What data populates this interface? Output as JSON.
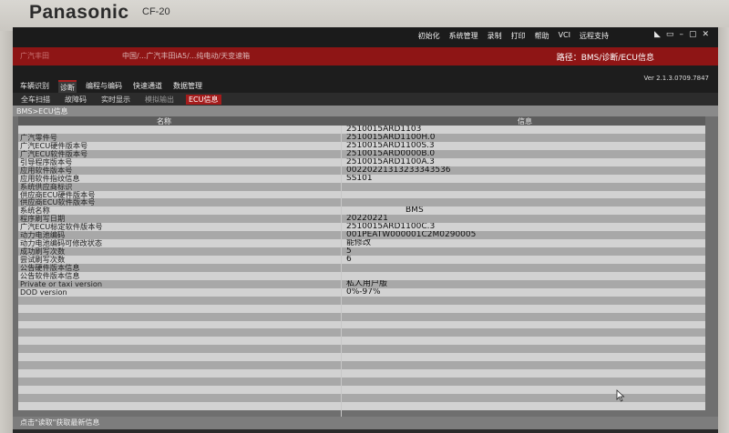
{
  "device": {
    "brand": "Panasonic",
    "model": "CF-20"
  },
  "topmenu": [
    "初始化",
    "系统管理",
    "录制",
    "打印",
    "帮助",
    "VCI",
    "远程支持"
  ],
  "header": {
    "logo_text": "广汽丰田",
    "crumb_path": "中国/...广汽丰田iA5/...纯电动/天变速箱",
    "path_label": "路径：BMS/诊断/ECU信息",
    "version": "Ver 2.1.3.0709.7847"
  },
  "nav": {
    "tabs": [
      "车辆识别",
      "诊断",
      "编程与编码",
      "快速通道",
      "数据管理"
    ],
    "active_tab": "诊断",
    "subtabs": [
      "全车扫描",
      "故障码",
      "实时显示",
      "模拟输出",
      "ECU信息"
    ],
    "active_subtab": "ECU信息"
  },
  "breadcrumb": "BMS>ECU信息",
  "table": {
    "col_name": "名称",
    "col_info": "信息",
    "rows": [
      {
        "name": "",
        "value": "2510015ARD1103"
      },
      {
        "name": "广汽零件号",
        "value": "2510015ARD1100H.0"
      },
      {
        "name": "广汽ECU硬件版本号",
        "value": "2510015ARD1100S.3"
      },
      {
        "name": "广汽ECU软件版本号",
        "value": "2510015ARD0000B.0"
      },
      {
        "name": "引导程序版本号",
        "value": "2510015ARD1100A.3"
      },
      {
        "name": "应用软件版本号",
        "value": "00220221313233343536"
      },
      {
        "name": "应用软件指纹信息",
        "value": "SS101"
      },
      {
        "name": "系统供应商标识",
        "value": ""
      },
      {
        "name": "供应商ECU硬件版本号",
        "value": ""
      },
      {
        "name": "供应商ECU软件版本号",
        "value": ""
      },
      {
        "name": "系统名称",
        "value": "BMS",
        "center": true
      },
      {
        "name": "程序刷写日期",
        "value": "20220221"
      },
      {
        "name": "广汽ECU标定软件版本号",
        "value": "2510015ARD1100C.3"
      },
      {
        "name": "动力电池编码",
        "value": "001PEATW000001C2M0290005"
      },
      {
        "name": "动力电池编码可修改状态",
        "value": "能修改"
      },
      {
        "name": "成功刷写次数",
        "value": "5"
      },
      {
        "name": "尝试刷写次数",
        "value": "6"
      },
      {
        "name": "公告硬件版本信息",
        "value": ""
      },
      {
        "name": "公告软件版本信息",
        "value": ""
      },
      {
        "name": "Private or taxi version",
        "value": "私人用户版"
      },
      {
        "name": "DOD version",
        "value": "0%-97%"
      },
      {
        "name": "",
        "value": ""
      },
      {
        "name": "",
        "value": ""
      },
      {
        "name": "",
        "value": ""
      },
      {
        "name": "",
        "value": ""
      },
      {
        "name": "",
        "value": ""
      },
      {
        "name": "",
        "value": ""
      },
      {
        "name": "",
        "value": ""
      },
      {
        "name": "",
        "value": ""
      },
      {
        "name": "",
        "value": ""
      },
      {
        "name": "",
        "value": ""
      },
      {
        "name": "",
        "value": ""
      },
      {
        "name": "",
        "value": ""
      },
      {
        "name": "",
        "value": ""
      },
      {
        "name": "",
        "value": ""
      }
    ]
  },
  "status": "点击\"读取\"获取最新信息",
  "colors": {
    "accent_red": "#8e1515",
    "tab_red": "#a51c1c"
  }
}
